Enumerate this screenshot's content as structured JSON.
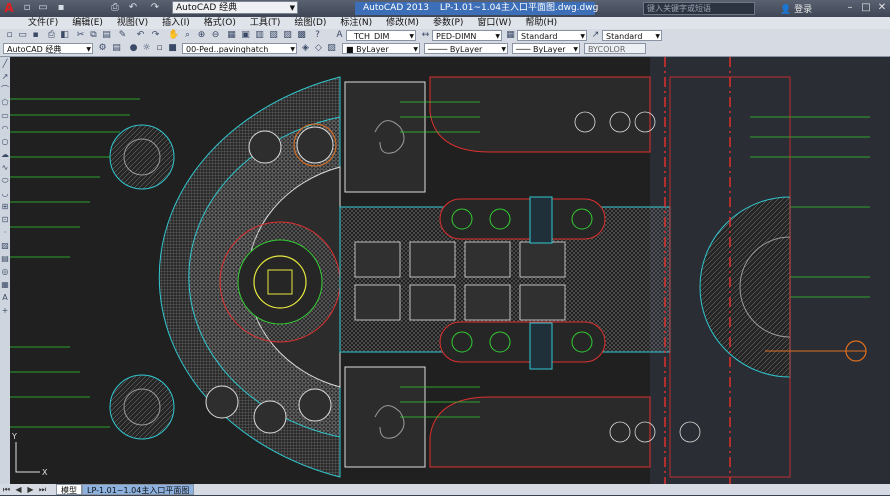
{
  "titlebar": {
    "workspace": "AutoCAD 经典",
    "app_title": "AutoCAD 2013",
    "file_title": "LP-1.01~1.04主入口平面图.dwg.dwg",
    "search_placeholder": "键入关键字或短语",
    "login": "登录"
  },
  "menu": [
    "文件(F)",
    "编辑(E)",
    "视图(V)",
    "插入(I)",
    "格式(O)",
    "工具(T)",
    "绘图(D)",
    "标注(N)",
    "修改(M)",
    "参数(P)",
    "窗口(W)",
    "帮助(H)"
  ],
  "toolbar": {
    "text_style": "_TCH_DIM",
    "dim_style": "PED-DIMN",
    "table_style": "Standard",
    "multileader_style": "Standard",
    "workspace2": "AutoCAD 经典",
    "layer": "00-Ped..pavinghatch",
    "color": "ByLayer",
    "linetype": "ByLayer",
    "lineweight": "ByLayer",
    "plotstyle": "BYCOLOR"
  },
  "tabs": {
    "model": "模型",
    "layout": "LP-1.01~1.04主入口平面图"
  },
  "colors": {
    "canvas": "#202020",
    "accent_red": "#e03030",
    "green": "#33cc33",
    "cyan": "#30c8d0",
    "yellow": "#e8e840"
  }
}
